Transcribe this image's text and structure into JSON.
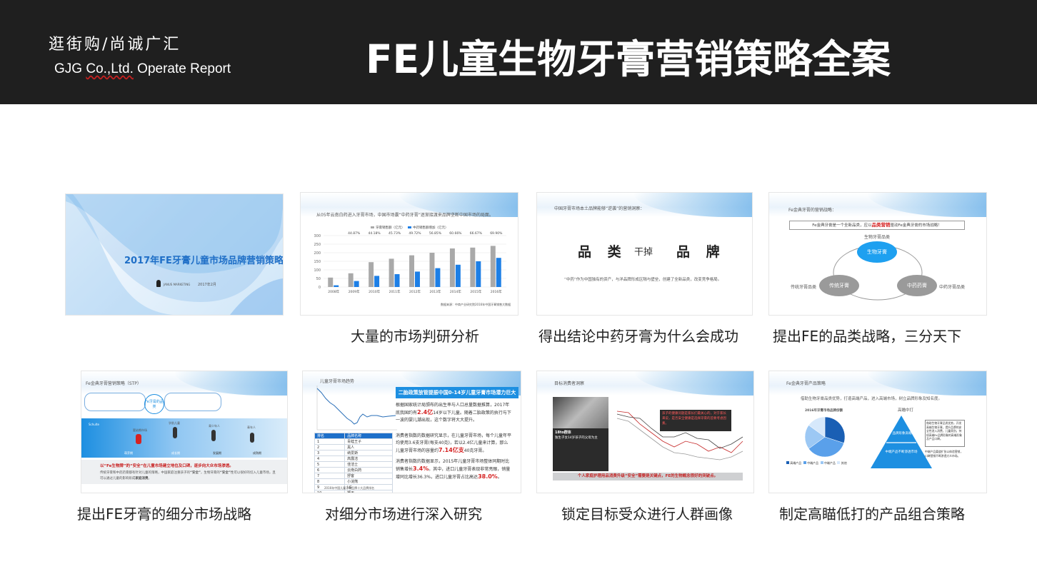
{
  "header": {
    "brand_cn": "逛街购/尚诚广汇",
    "brand_en_a": "GJG ",
    "brand_en_b": "Co.,Ltd.",
    "brand_en_c": " Operate Report",
    "title": "FE儿童生物牙膏营销策略全案"
  },
  "colors": {
    "header_bg": "#1f1f1f",
    "accent_blue": "#1d8fe1",
    "accent_red": "#d52222"
  },
  "slides": [
    {
      "caption": "",
      "title": "2017年FE牙膏儿童市场品牌营销策略",
      "footer_brand": "JANUS MARKETING",
      "footer_date": "2017年2月"
    },
    {
      "caption": "大量的市场判研分析",
      "intro": "从05年云南白药进入牙膏市场，中国市场囊“中药牙膏”逐渐接渡来品牌垄断中国市场的局面。",
      "legend_a": "牙膏销售额（亿元）",
      "legend_b": "中药销售额增加（亿元）",
      "source": "数据来源：中商产业研究院2016年中国牙膏销售大数据",
      "chart_data": {
        "type": "bar",
        "categories": [
          "2008年",
          "2009年",
          "2010年",
          "2011年",
          "2012年",
          "2013年",
          "2014年",
          "2015年",
          "2016年"
        ],
        "series": [
          {
            "name": "牙膏销售额（亿元）",
            "values": [
              55,
              80,
              145,
              165,
              185,
              200,
              225,
              230,
              240
            ]
          },
          {
            "name": "中药销售额增加（亿元）",
            "values": [
              10,
              35,
              65,
              75,
              90,
              110,
              130,
              150,
              170
            ]
          }
        ],
        "percent_labels": [
          "",
          "44.87%",
          "44.18%",
          "45.73%",
          "49.72%",
          "56.85%",
          "60.66%",
          "66.67%",
          "69.90%"
        ],
        "yticks": [
          "0",
          "50",
          "100",
          "150",
          "200",
          "250",
          "300"
        ],
        "ylim": [
          0,
          300
        ]
      }
    },
    {
      "caption": "得出结论中药牙膏为什么会成功",
      "header": "中国牙膏市场本土品牌能够“逆袭”的营销洞察：",
      "word_a": "品 类",
      "word_b": "干掉",
      "word_c": "品 牌",
      "note": "“中药”作为中国独有的资产，与洋品牌形成区隔与壁垒，创建了全新品类，改变竞争格局。"
    },
    {
      "caption": "提出FE的品类战略，三分天下",
      "header": "Fe金典牙膏的营销战略：",
      "box_a": "Fe金典牙膏是一个全新品类，应以",
      "box_b": "品类营销",
      "box_c": "驱动Fe金典牙膏的市场战略！",
      "top_label": "生物牙膏品类",
      "circle_top": "生物牙膏",
      "circle_left": "传统牙膏",
      "circle_right": "中药药膏",
      "left_label": "传统牙膏品类",
      "right_label": "中药牙膏品类"
    },
    {
      "caption": "提出FE牙膏的细分市场战略",
      "header": "Fe金典牙膏营销策略（STP）",
      "center_bubble": "Fe牙膏的品类",
      "band_left": "Schulte",
      "stages": [
        "萌芽期",
        "成长期",
        "发展期",
        "成熟期"
      ],
      "runner_labels": [
        "婴幼期市场",
        "学前儿童",
        "青少年人",
        "青年人"
      ],
      "red_line": "以“Fe生物牌”的“安全”在儿童市场建立地位及口碑，逐步向大众市场渗透。",
      "sub_line_a": "传统牙膏和中药药膏都有针对儿童的策略，中国家庭注重孩子的",
      "sub_line_b": "“安全”",
      "sub_line_c": "，生物牙膏的",
      "sub_line_d": "“安全”",
      "sub_line_e": "性可以很好的切入儿童市场，且可以通过儿童的影响形成",
      "sub_line_f": "家庭消费",
      "sub_line_g": "。"
    },
    {
      "caption": "对细分市场进行深入研究",
      "chart_title": "儿童牙膏市场趋势",
      "bar_text": "二胎政策放管提振中国0-14岁儿童牙膏市场潜力巨大",
      "p1_a": "根据国家统计局颁布的出生率与人口总量数据推算，2017年底我国约有",
      "p1_b": "2.4亿",
      "p1_c": "14岁以下儿童。随着二胎政策的执行与下一波的婴儿潮出现，这个数字将大大提升。",
      "p2_a": "消费者指数的数据研究显示，在儿童牙膏市场，每个儿童年平均使用3.6支牙膏(每支40克)，若以2.4亿儿童来计算，那么儿童牙膏市场的容量约",
      "p2_b": "7.14亿支",
      "p2_c": "40克牙膏。",
      "p3_a": "消费者指数的数据显示，2015年儿童牙膏市场整体同期时比销售增长",
      "p3_b": "3.4%",
      "p3_c": "。其中，进口儿童牙膏表现非常亮眼，销量增同比增长36.3%，进口儿童牙膏占比高达",
      "p3_d": "38.0%",
      "p3_e": "。",
      "table_caption": "2016年中国儿童牙膏品牌十大品牌排名",
      "table_header": [
        "排名",
        "品牌名称"
      ],
      "table_rows": [
        [
          "1",
          "青蛙王子"
        ],
        [
          "2",
          "黑人"
        ],
        [
          "3",
          "纳爱斯"
        ],
        [
          "4",
          "高露洁"
        ],
        [
          "5",
          "佳洁士"
        ],
        [
          "6",
          "云南白药"
        ],
        [
          "7",
          "舒客"
        ],
        [
          "8",
          "小浣熊"
        ],
        [
          "9",
          "LG"
        ],
        [
          "10",
          "狮王"
        ]
      ]
    },
    {
      "caption": "锁定目标受众进行人群画像",
      "header": "目标消费者洞察",
      "dark_box": "孩子的健康问题是家长们最关心的，对于家长来说，是否安全健康是选择牙膏的首要考虑因素。",
      "left_title": "18to群体",
      "left_sub": "独生子女14岁孩子的父母为主",
      "strip": "个人家庭护理用品消费升级“安全”需要是关键点，FE的生物概念很好的突破点。"
    },
    {
      "caption": "制定高瞄低打的产品组合策略",
      "header": "Fe金典牙膏产品策略",
      "intro": "借助生物牙膏品类优势，打造高端产品，进入高端市场，树立品牌形象及知名度。",
      "pie_title": "2016年牙膏市场品牌份额",
      "right_title": "高瞄中打",
      "pyr_top": "品牌形象高端",
      "pyr_bottom": "中端产品不断渗透市场",
      "side_a": "借助生物牙膏品类优势，开发高端生物牙膏，提升品牌的安全性进入消费，儿童类别，持续高端Fe品牌形象的高端形象及产品口碑。",
      "side_b": "中端产品渠道扩张以体验营销，口碑营销不断渗透大众市场。",
      "legend": [
        "高端产品",
        "中端产品",
        "中端产品",
        "其他"
      ],
      "chart_data": {
        "type": "pie",
        "labels": [
          "高端产品",
          "中端产品",
          "中端产品",
          "其他"
        ],
        "values": [
          30,
          35,
          20,
          15
        ]
      }
    }
  ]
}
